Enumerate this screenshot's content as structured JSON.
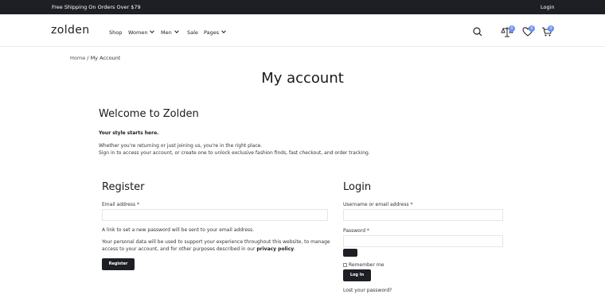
{
  "topbar": {
    "promo": "Free Shipping On Orders Over $79",
    "login": "Login"
  },
  "header": {
    "logo": "zolden",
    "nav": [
      {
        "label": "Shop",
        "has_menu": false
      },
      {
        "label": "Women",
        "has_menu": true
      },
      {
        "label": "Men",
        "has_menu": true
      },
      {
        "label": "Sale",
        "has_menu": false
      },
      {
        "label": "Pages",
        "has_menu": true
      }
    ],
    "icons": {
      "search": "search-icon",
      "compare": "compare-icon",
      "wishlist": "heart-icon",
      "cart": "cart-icon"
    },
    "compare_count": "0",
    "wishlist_count": "0",
    "cart_count": "0"
  },
  "breadcrumb": {
    "home": "Home",
    "separator": "/",
    "current": "My Account"
  },
  "page_title": "My account",
  "welcome": {
    "heading": "Welcome to Zolden",
    "tagline": "Your style starts here.",
    "line1": "Whether you're returning or just joining us, you're in the right place.",
    "line2": "Sign in to access your account, or create one to unlock exclusive fashion finds, fast checkout, and order tracking."
  },
  "register": {
    "heading": "Register",
    "email_label": "Email address *",
    "email_value": "",
    "password_note": "A link to set a new password will be sent to your email address.",
    "privacy_text_1": "Your personal data will be used to support your experience throughout this website, to manage",
    "privacy_text_2": "access to your account, and for other purposes described in our",
    "privacy_link": "privacy policy",
    "privacy_end": ".",
    "button": "Register"
  },
  "login": {
    "heading": "Login",
    "username_label": "Username or email address *",
    "username_value": "",
    "password_label": "Password *",
    "password_value": "",
    "remember_label": "Remember me",
    "remember_checked": false,
    "button": "Log In",
    "lost_password": "Lost your password?"
  },
  "colors": {
    "dark": "#1d1f24",
    "badge": "#6c8ff0",
    "border": "#e6e6e6"
  }
}
